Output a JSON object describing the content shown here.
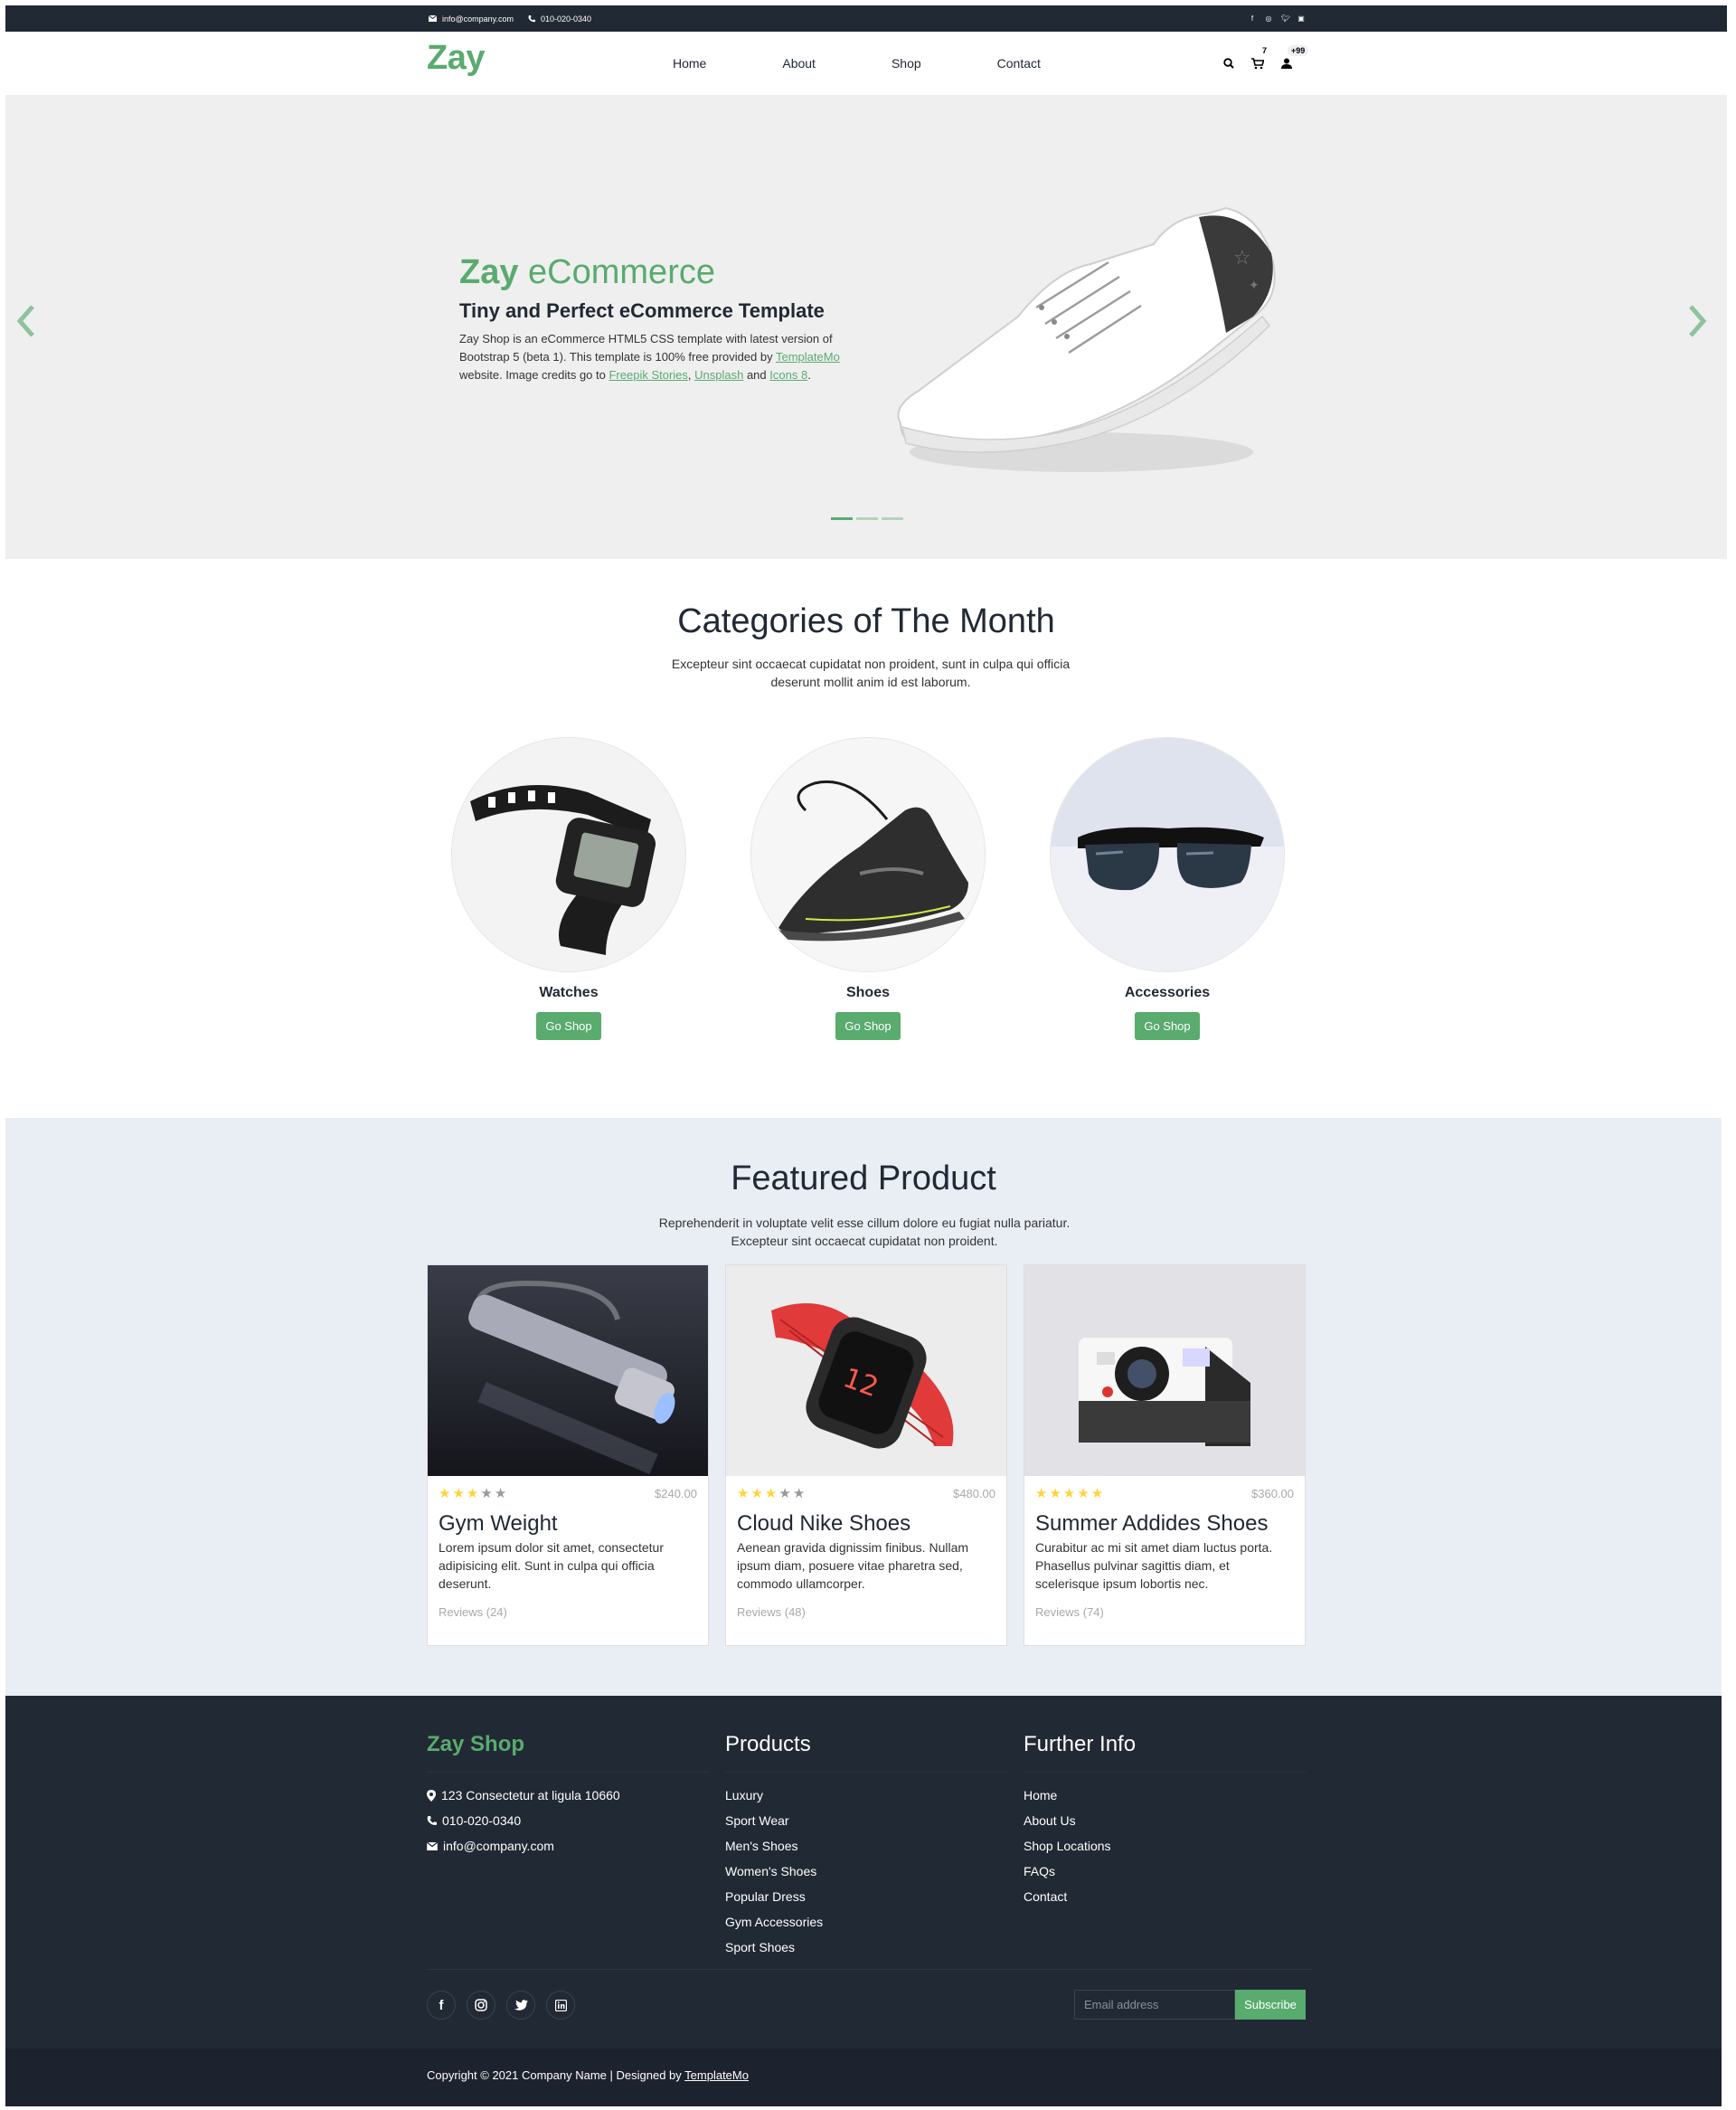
{
  "topbar": {
    "email": "info@company.com",
    "phone": "010-020-0340",
    "social_icons": [
      "facebook-icon",
      "instagram-icon",
      "twitter-icon",
      "linkedin-icon"
    ]
  },
  "nav": {
    "logo": "Zay",
    "menu": [
      "Home",
      "About",
      "Shop",
      "Contact"
    ],
    "cart_count": "7",
    "user_count": "+99"
  },
  "hero": {
    "title_bold": "Zay",
    "title_light": " eCommerce",
    "subtitle": "Tiny and Perfect eCommerce Template",
    "desc_1": "Zay Shop is an eCommerce HTML5 CSS template with latest version of Bootstrap 5 (beta 1). This template is 100% free provided by ",
    "link_templatemo": "TemplateMo",
    "desc_2": " website. Image credits go to ",
    "link_freepik": "Freepik Stories",
    "sep_1": ", ",
    "link_unsplash": "Unsplash",
    "desc_3": " and ",
    "link_icons8": "Icons 8",
    "desc_end": ".",
    "slide_count": 3,
    "active_slide": 1
  },
  "categories": {
    "title": "Categories of The Month",
    "desc": "Excepteur sint occaecat cupidatat non proident, sunt in culpa qui officia deserunt mollit anim id est laborum.",
    "items": [
      {
        "name": "Watches",
        "button": "Go Shop"
      },
      {
        "name": "Shoes",
        "button": "Go Shop"
      },
      {
        "name": "Accessories",
        "button": "Go Shop"
      }
    ]
  },
  "featured": {
    "title": "Featured Product",
    "desc": "Reprehenderit in voluptate velit esse cillum dolore eu fugiat nulla pariatur. Excepteur sint occaecat cupidatat non proident.",
    "products": [
      {
        "name": "Gym Weight",
        "price": "$240.00",
        "rating": 3,
        "desc": "Lorem ipsum dolor sit amet, consectetur adipisicing elit. Sunt in culpa qui officia deserunt.",
        "reviews": "Reviews (24)"
      },
      {
        "name": "Cloud Nike Shoes",
        "price": "$480.00",
        "rating": 3,
        "desc": "Aenean gravida dignissim finibus. Nullam ipsum diam, posuere vitae pharetra sed, commodo ullamcorper.",
        "reviews": "Reviews (48)"
      },
      {
        "name": "Summer Addides Shoes",
        "price": "$360.00",
        "rating": 5,
        "desc": "Curabitur ac mi sit amet diam luctus porta. Phasellus pulvinar sagittis diam, et scelerisque ipsum lobortis nec.",
        "reviews": "Reviews (74)"
      }
    ]
  },
  "footer": {
    "brand": "Zay Shop",
    "address": "123 Consectetur at ligula 10660",
    "phone": "010-020-0340",
    "email": "info@company.com",
    "products_title": "Products",
    "products": [
      "Luxury",
      "Sport Wear",
      "Men's Shoes",
      "Women's Shoes",
      "Popular Dress",
      "Gym Accessories",
      "Sport Shoes"
    ],
    "info_title": "Further Info",
    "info": [
      "Home",
      "About Us",
      "Shop Locations",
      "FAQs",
      "Contact"
    ],
    "email_placeholder": "Email address",
    "subscribe": "Subscribe",
    "copyright": "Copyright © 2021 Company Name | Designed by ",
    "copyright_link": "TemplateMo"
  },
  "colors": {
    "accent": "#59ab6e",
    "dark": "#212934",
    "hero_bg": "#efefef",
    "featured_bg": "#e9eef5",
    "star": "#ffd43b"
  }
}
